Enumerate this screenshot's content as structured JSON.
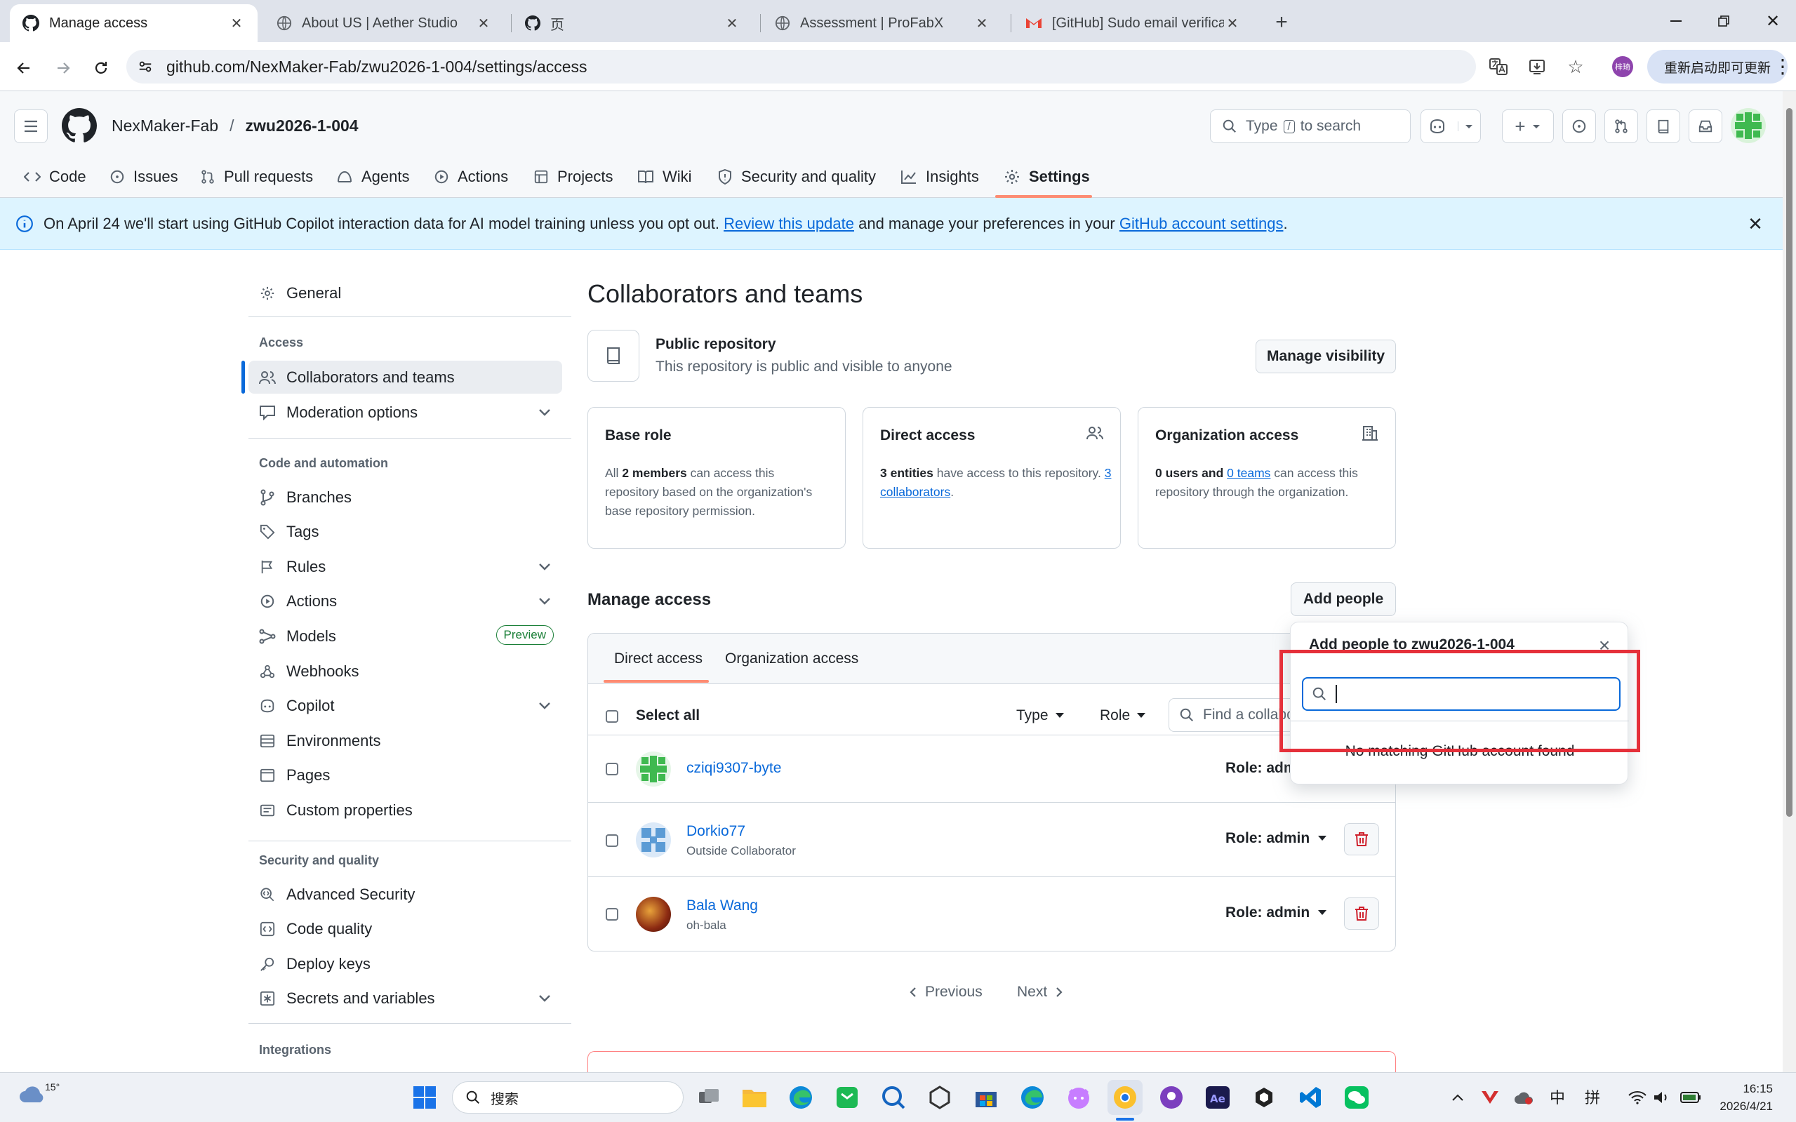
{
  "browser": {
    "tabs": [
      {
        "label": "Manage access",
        "active": true
      },
      {
        "label": "About US | Aether Studio",
        "active": false
      },
      {
        "label": "页",
        "active": false
      },
      {
        "label": "Assessment | ProFabX",
        "active": false
      },
      {
        "label": "[GitHub] Sudo email verificat",
        "active": false
      }
    ],
    "new_tab": "+",
    "url": "github.com/NexMaker-Fab/zwu2026-1-004/settings/access",
    "profile_initials": "梓琦",
    "restart_label": "重新启动即可更新"
  },
  "header": {
    "owner": "NexMaker-Fab",
    "separator": "/",
    "repo": "zwu2026-1-004",
    "search_prefix": "Type",
    "search_key": "/",
    "search_suffix": "to search"
  },
  "repo_nav": [
    {
      "label": "Code",
      "icon": "code-icon"
    },
    {
      "label": "Issues",
      "icon": "issue-icon"
    },
    {
      "label": "Pull requests",
      "icon": "pull-request-icon"
    },
    {
      "label": "Agents",
      "icon": "agent-icon"
    },
    {
      "label": "Actions",
      "icon": "play-icon"
    },
    {
      "label": "Projects",
      "icon": "table-icon"
    },
    {
      "label": "Wiki",
      "icon": "book-icon"
    },
    {
      "label": "Security and quality",
      "icon": "shield-icon"
    },
    {
      "label": "Insights",
      "icon": "graph-icon"
    },
    {
      "label": "Settings",
      "icon": "gear-icon",
      "selected": true
    }
  ],
  "banner": {
    "prefix": "On April 24 we'll start using GitHub Copilot interaction data for AI model training unless you opt out.",
    "link1": "Review this update",
    "middle": "and manage your preferences in your",
    "link2": "GitHub account settings",
    "suffix": "."
  },
  "sidebar": {
    "general": "General",
    "access_heading": "Access",
    "access_items": [
      "Collaborators and teams",
      "Moderation options"
    ],
    "code_heading": "Code and automation",
    "code_items": [
      "Branches",
      "Tags",
      "Rules",
      "Actions",
      "Models",
      "Webhooks",
      "Copilot",
      "Environments",
      "Pages",
      "Custom properties"
    ],
    "preview_badge": "Preview",
    "security_heading": "Security and quality",
    "security_items": [
      "Advanced Security",
      "Code quality",
      "Deploy keys",
      "Secrets and variables"
    ],
    "integrations_heading": "Integrations"
  },
  "main": {
    "title": "Collaborators and teams",
    "visibility": {
      "title": "Public repository",
      "desc": "This repository is public and visible to anyone",
      "button": "Manage visibility"
    },
    "cards": {
      "base_role": {
        "title": "Base role",
        "t1": "All",
        "bold": "2 members",
        "t2": "can access this repository based on the organization's base repository permission."
      },
      "direct": {
        "title": "Direct access",
        "bold": "3 entities",
        "t1": "have access to this repository.",
        "link": "3 collaborators",
        "t2": "."
      },
      "org": {
        "title": "Organization access",
        "bold": "0 users and",
        "link": "0 teams",
        "t1": "can access this repository through the organization."
      }
    },
    "manage_title": "Manage access",
    "add_people": "Add people",
    "tabs": [
      "Direct access",
      "Organization access"
    ],
    "select_all": "Select all",
    "type_filter": "Type",
    "role_filter": "Role",
    "find_placeholder": "Find a collaborator…",
    "collaborators": [
      {
        "name": "cziqi9307-byte",
        "sub": "",
        "role": "Role: admin"
      },
      {
        "name": "Dorkio77",
        "sub": "Outside Collaborator",
        "role": "Role: admin"
      },
      {
        "name": "Bala Wang",
        "sub": "oh-bala",
        "role": "Role: admin"
      }
    ],
    "pagination": {
      "prev": "Previous",
      "next": "Next"
    }
  },
  "popover": {
    "title": "Add people to zwu2026-1-004",
    "empty": "No matching GitHub account found",
    "close": "×"
  },
  "taskbar": {
    "weather_temp": "15°",
    "search_label": "搜索",
    "ime1": "中",
    "ime2": "拼",
    "time": "16:15",
    "date": "2026/4/21"
  },
  "colors": {
    "accent": "#0969da",
    "active_nav": "#fd8c73",
    "danger": "#cf222e",
    "highlight": "#e5303a"
  }
}
